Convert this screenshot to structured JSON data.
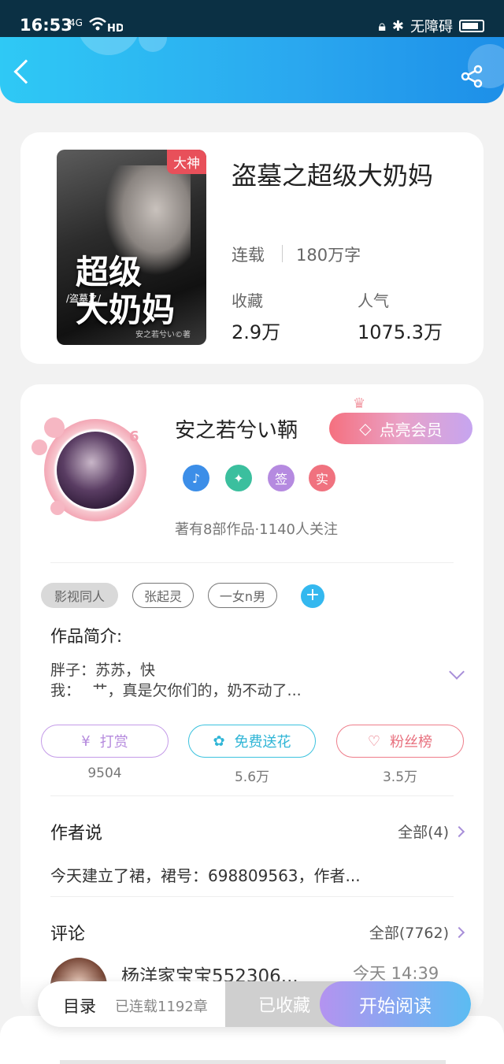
{
  "status_bar": {
    "time": "16:53",
    "network": "4G",
    "wifi_label": "HD",
    "accessibility": "无障碍"
  },
  "header": {
    "back_icon": "chevron-left-icon",
    "share_icon": "share-icon"
  },
  "book": {
    "cover_tag": "大神",
    "cover_title_line1": "超级",
    "cover_title_line2": "大奶妈",
    "cover_subtitle": "/盗墓之/",
    "cover_author": "安之若兮い©著",
    "title": "盗墓之超级大奶妈",
    "status": "连载",
    "word_count": "180万字",
    "favorites_label": "收藏",
    "favorites_value": "2.9万",
    "popularity_label": "人气",
    "popularity_value": "1075.3万"
  },
  "author": {
    "level": "6",
    "name": "安之若兮い鞆",
    "vip_button": "点亮会员",
    "badges": [
      "♪",
      "✦",
      "签",
      "实"
    ],
    "works_info": "著有8部作品·1140人关注"
  },
  "tags": [
    "影视同人",
    "张起灵",
    "一女n男"
  ],
  "intro": {
    "label": "作品简介:",
    "line1": "胖子：苏苏，快",
    "line2": "我：　 艹，真是欠你们的，奶不动了..."
  },
  "actions": [
    {
      "label": "打赏",
      "count": "9504"
    },
    {
      "label": "免费送花",
      "count": "5.6万"
    },
    {
      "label": "粉丝榜",
      "count": "3.5万"
    }
  ],
  "author_says": {
    "title": "作者说",
    "more": "全部(4)",
    "text": "今天建立了裙，裙号：698809563，作者..."
  },
  "comments": {
    "title": "评论",
    "more": "全部(7762)",
    "first_name": "杨洋家宝宝552306...",
    "first_time": "今天 14:39"
  },
  "bottom_bar": {
    "toc": "目录",
    "serial": "已连载1192章",
    "collected": "已收藏",
    "read": "开始阅读"
  }
}
